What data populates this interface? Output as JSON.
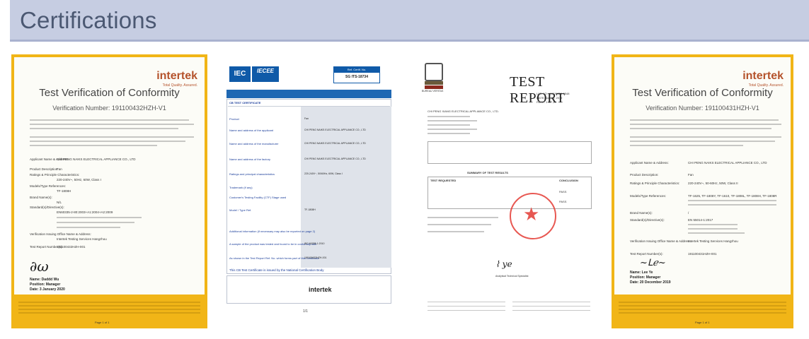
{
  "header": {
    "title": "Certifications"
  },
  "certificates": [
    {
      "brand": "intertek",
      "brand_tagline": "Total Quality. Assured.",
      "title": "Test Verification of Conformity",
      "verification": "Verification Number: 191100432HZH-V1",
      "fields": [
        {
          "label": "Applicant Name & Address:",
          "value": "CHI PENG NAIKS ELECTRICAL APPLIANCE CO., LTD"
        },
        {
          "label": "Product Description:",
          "value": "Fan"
        },
        {
          "label": "Ratings & Principle Characteristics:",
          "value": "220-240V~, 50Hz, 60W, Class I"
        },
        {
          "label": "Models/Type References:",
          "value": "TF-1808H"
        },
        {
          "label": "Brand Name(s):",
          "value": "N/L"
        },
        {
          "label": "Standard(s)/Directive(s):",
          "value": "EN60335-2-80:2003+A1:2004+A2:2009"
        },
        {
          "label": "Verification Issuing Office Name & Address:",
          "value": "Intertek Testing Services Hangzhou"
        },
        {
          "label": "Test Report Number(s):",
          "value": "191100432HZH-001"
        }
      ],
      "signer_name": "Name: Daddd Wu",
      "signer_position": "Position: Manager",
      "signer_date": "Date: 3 January 2020",
      "footer": "Page 1 of 1"
    },
    {
      "brand": "IEC IECEE",
      "ref_header": "Ref. Certif. No.",
      "ref_value": "SG ITS-18734",
      "banner": "IEC SYSTEM FOR MUTUAL RECOGNITION OF TEST CERTIFICATES FOR ELECTRICAL EQUIPMENT (IECEE) CB SCHEME",
      "section": "CB TEST CERTIFICATE",
      "rows": [
        "Product",
        "Name and address of the applicant",
        "Name and address of the manufacturer",
        "Name and address of the factory",
        "Ratings and principal characteristics",
        "Trademark (if any)",
        "Customer's Testing Facility (CTF) Stage used",
        "Model / Type Ref.",
        "Additional information (if necessary may also be reported on page 2)",
        "A sample of the product was tested and found to be in conformity with",
        "As shown in the Test Report Ref. No. which forms part of this Certificate"
      ],
      "values": [
        "Fan",
        "CHI PENG NAIKS ELECTRICAL APPLIANCE CO., LTD",
        "CHI PENG NAIKS ELECTRICAL APPLIANCE CO., LTD",
        "CHI PENG NAIKS ELECTRICAL APPLIANCE CO., LTD",
        "220-240V~, 50/60Hz, 60W, Class I",
        "",
        "",
        "TF-1808H",
        "",
        "IEC 60335-1:2010",
        "191100432HZH-001"
      ],
      "notice": "This CB Test Certificate is issued by the National Certification Body",
      "issuer": "intertek",
      "page": "1/1"
    },
    {
      "brand": "BUREAU VERITAS",
      "title": "TEST REPORT",
      "meta": [
        "LAB NO.: (6619)324-1548",
        "DATE: Nov 29, 2019",
        "PAGE: 1 OF 23"
      ],
      "company": "CHI PENG XIANG ELECTRICAL APPLIANCE CO., LTD.",
      "summary_title": "SUMMARY OF TEST RESULTS",
      "summary_header": [
        "TEST REQUESTED",
        "CONCLUSION"
      ],
      "summary_rows": [
        "PASS",
        "PASS"
      ],
      "signer": "Analytical Technical Specialist"
    },
    {
      "brand": "intertek",
      "brand_tagline": "Total Quality. Assured.",
      "title": "Test Verification of Conformity",
      "verification": "Verification Number: 191100431HZH-V1",
      "fields": [
        {
          "label": "Applicant Name & Address:",
          "value": "CHI PENG NAIKS ELECTRICAL APPLIANCE CO., LTD"
        },
        {
          "label": "Product Description:",
          "value": "Fan"
        },
        {
          "label": "Ratings & Principle Characteristics:",
          "value": "220-240V~, 50-60Hz, 50W, Class II"
        },
        {
          "label": "Models/Type References:",
          "value": "TF-1625, TF-1808Y, TF-1610, TF-1808L, TF-1808H, TF-1808R"
        },
        {
          "label": "Brand Name(s):",
          "value": "/"
        },
        {
          "label": "Standard(s)/Directive(s):",
          "value": "EN 55014-1:2017"
        },
        {
          "label": "Verification Issuing Office Name & Address:",
          "value": "Intertek Testing Services Hangzhou"
        },
        {
          "label": "Test Report Number(s):",
          "value": "191100431HZH-001"
        }
      ],
      "signer_name": "Name: Lee Ye",
      "signer_position": "Position: Manager",
      "signer_date": "Date: 20 December 2019",
      "footer": "Page 1 of 1"
    }
  ]
}
